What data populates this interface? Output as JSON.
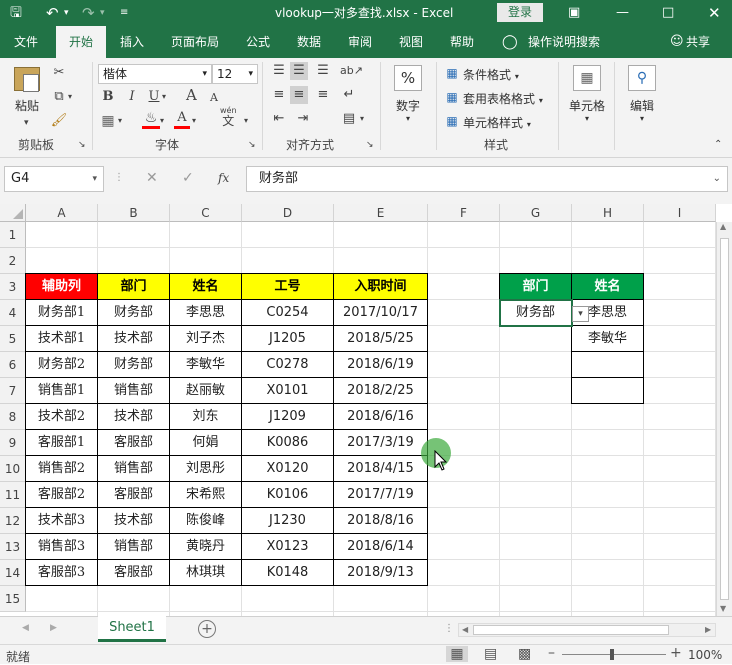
{
  "title_bar": {
    "save_icon": "save-icon",
    "undo_icon": "undo-icon",
    "redo_icon": "redo-icon",
    "filename": "vlookup一对多查找.xlsx",
    "separator": "-",
    "app": "Excel",
    "login": "登录",
    "ribbon_display_icon": "ribbon-display-icon",
    "minimize_icon": "minimize-icon",
    "restore_icon": "restore-icon",
    "close_icon": "close-icon"
  },
  "tabs": [
    "文件",
    "开始",
    "插入",
    "页面布局",
    "公式",
    "数据",
    "审阅",
    "视图",
    "帮助"
  ],
  "tell_me": "操作说明搜索",
  "share": "共享",
  "ribbon": {
    "clipboard": {
      "paste": "粘贴",
      "label": "剪贴板"
    },
    "font": {
      "name": "楷体",
      "size": "12",
      "label": "字体",
      "bold": "B",
      "italic": "I",
      "underline": "U",
      "grow": "A",
      "shrink": "A",
      "wen": "wén",
      "wen_char": "文"
    },
    "align": {
      "label": "对齐方式"
    },
    "number": {
      "button": "数字",
      "icon": "%"
    },
    "styles": {
      "conditional": "条件格式",
      "table": "套用表格格式",
      "cell": "单元格样式",
      "label": "样式"
    },
    "cells": {
      "button": "单元格"
    },
    "editing": {
      "button": "编辑"
    }
  },
  "formula_bar": {
    "name_box": "G4",
    "fx": "fx",
    "value": "财务部"
  },
  "columns": [
    "A",
    "B",
    "C",
    "D",
    "E",
    "F",
    "G",
    "H",
    "I"
  ],
  "rows": [
    "1",
    "2",
    "3",
    "4",
    "5",
    "6",
    "7",
    "8",
    "9",
    "10",
    "11",
    "12",
    "13",
    "14",
    "15"
  ],
  "table": {
    "headers": [
      "辅助列",
      "部门",
      "姓名",
      "工号",
      "入职时间"
    ],
    "rows": [
      [
        "财务部1",
        "财务部",
        "李思思",
        "C0254",
        "2017/10/17"
      ],
      [
        "技术部1",
        "技术部",
        "刘子杰",
        "J1205",
        "2018/5/25"
      ],
      [
        "财务部2",
        "财务部",
        "李敏华",
        "C0278",
        "2018/6/19"
      ],
      [
        "销售部1",
        "销售部",
        "赵丽敏",
        "X0101",
        "2018/2/25"
      ],
      [
        "技术部2",
        "技术部",
        "刘东",
        "J1209",
        "2018/6/16"
      ],
      [
        "客服部1",
        "客服部",
        "何娟",
        "K0086",
        "2017/3/19"
      ],
      [
        "销售部2",
        "销售部",
        "刘思彤",
        "X0120",
        "2018/4/15"
      ],
      [
        "客服部2",
        "客服部",
        "宋希熙",
        "K0106",
        "2017/7/19"
      ],
      [
        "技术部3",
        "技术部",
        "陈俊峰",
        "J1230",
        "2018/8/16"
      ],
      [
        "销售部3",
        "销售部",
        "黄晓丹",
        "X0123",
        "2018/6/14"
      ],
      [
        "客服部3",
        "客服部",
        "林琪琪",
        "K0148",
        "2018/9/13"
      ]
    ]
  },
  "lookup": {
    "headers": [
      "部门",
      "姓名"
    ],
    "dept": "财务部",
    "results": [
      "李思思",
      "李敏华",
      "",
      ""
    ]
  },
  "sheet_tab": "Sheet1",
  "status": {
    "ready": "就绪",
    "zoom": "100%"
  },
  "colors": {
    "excel_green": "#217346",
    "header_red": "#ff0000",
    "header_yellow": "#ffff00",
    "header_green": "#00a04a"
  }
}
